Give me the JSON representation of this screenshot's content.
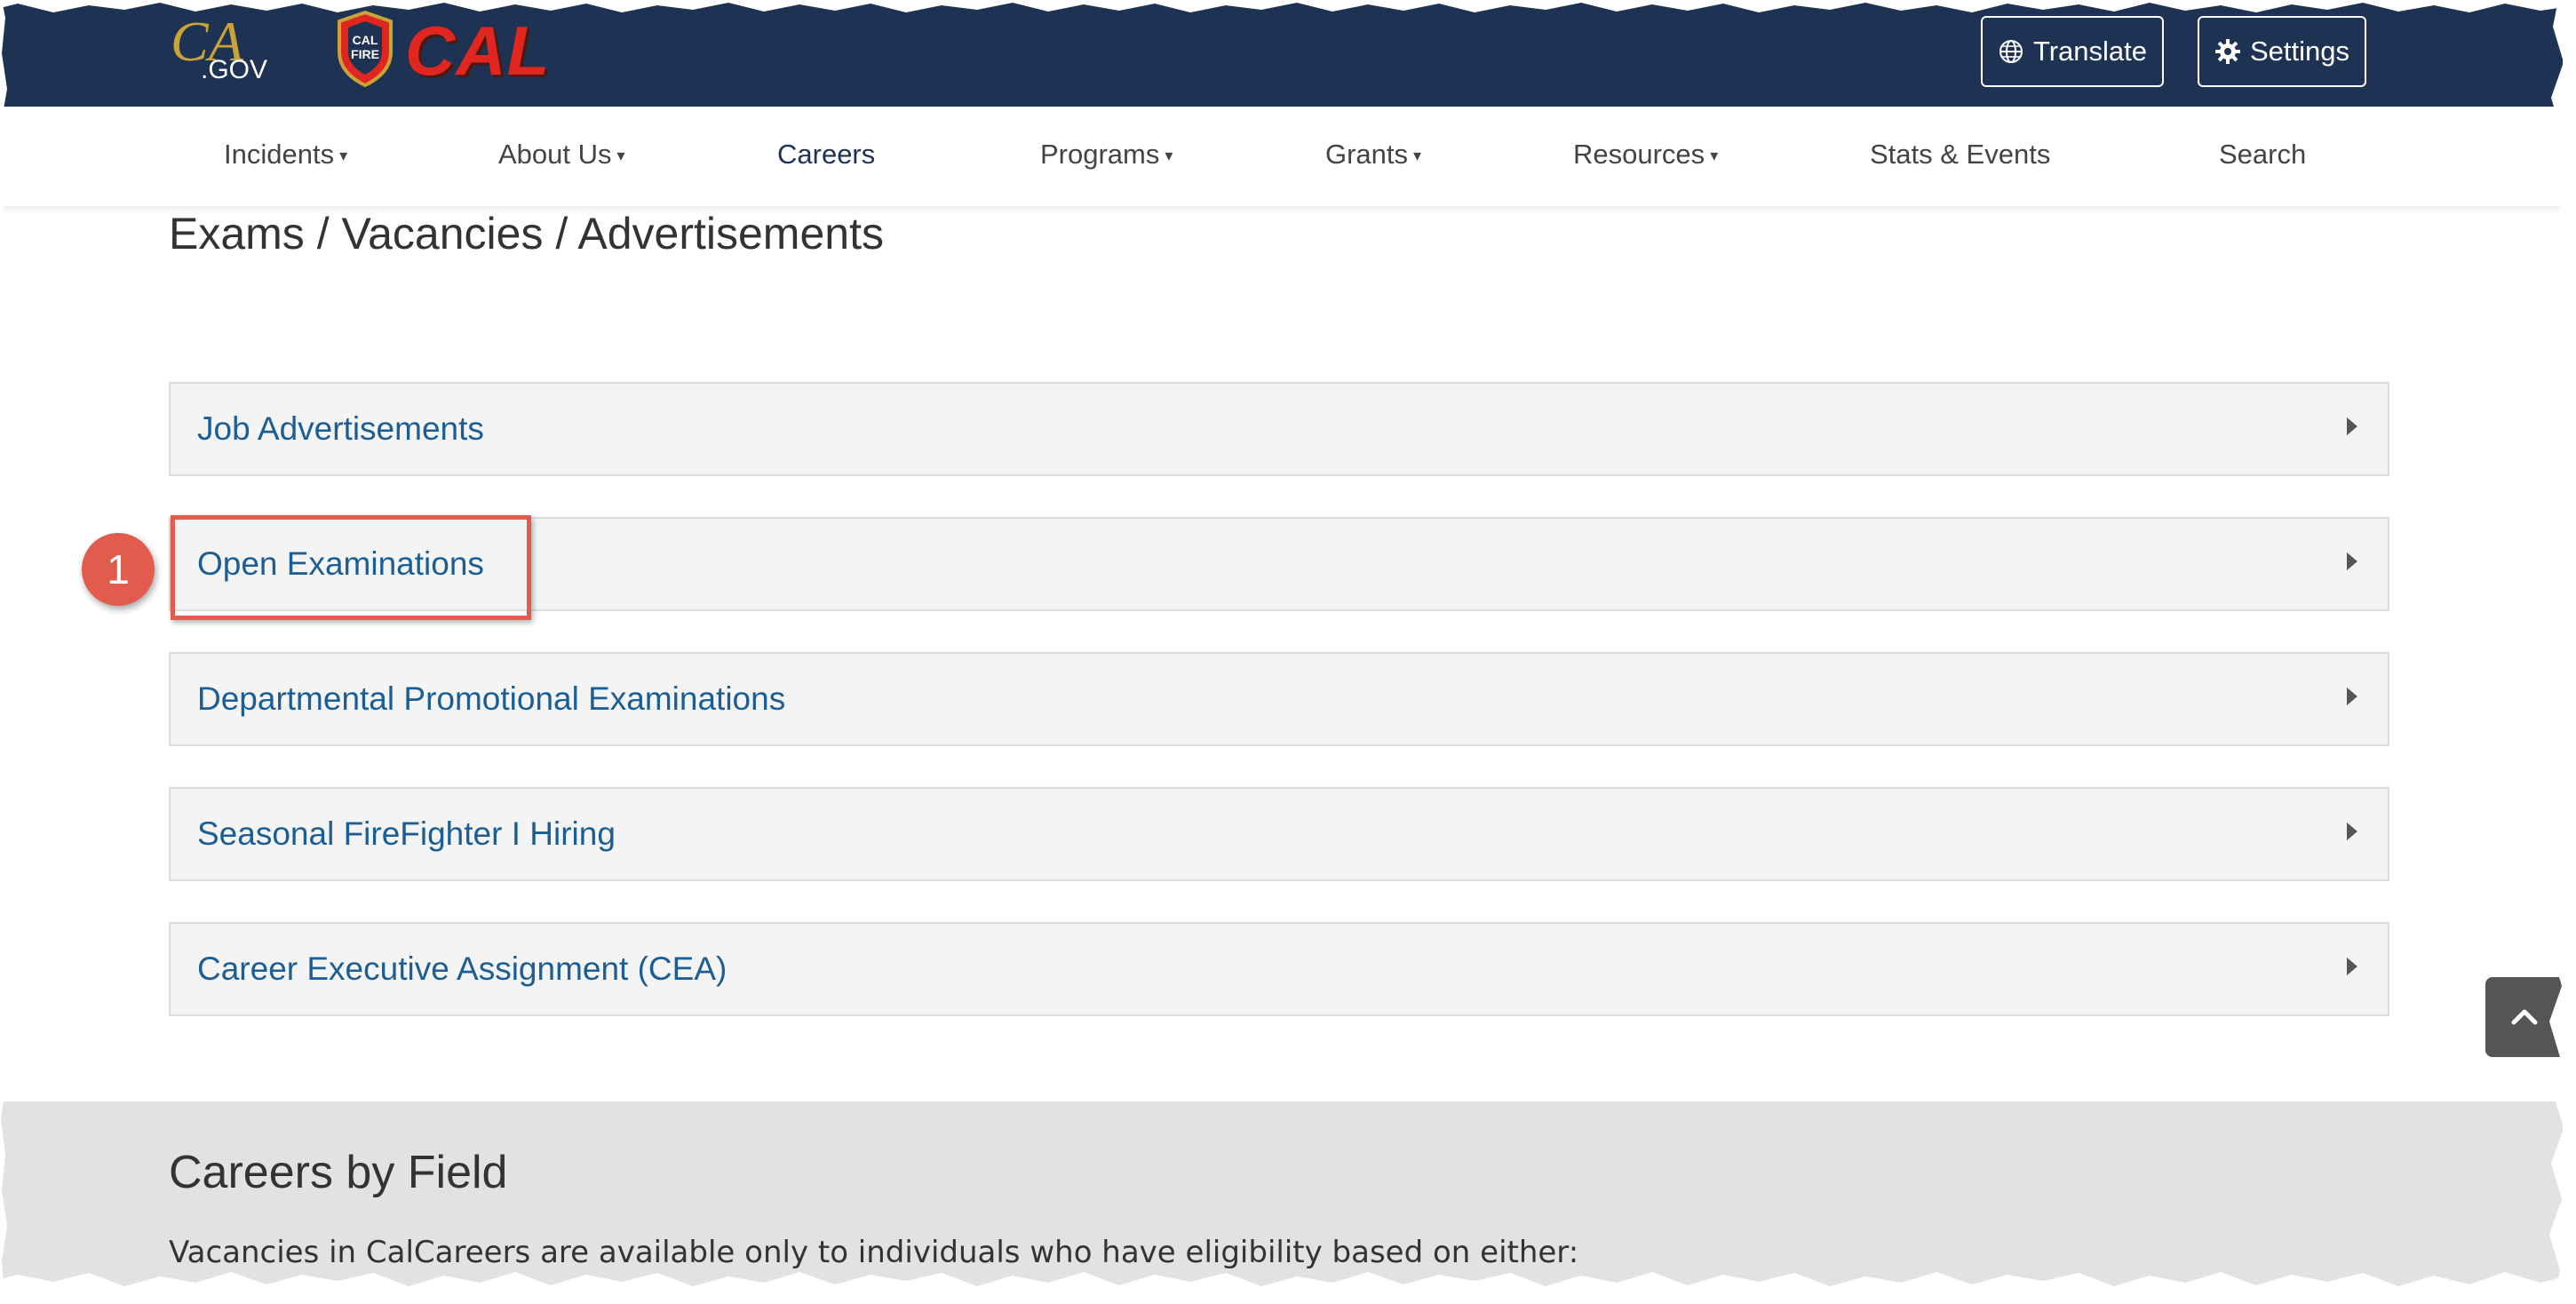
{
  "header": {
    "ca_logo_text": ".GOV",
    "ca_logo_mark": "CA",
    "brand": "CAL FIRE",
    "badge_text_1": "CAL",
    "badge_text_2": "FIRE",
    "translate_label": "Translate",
    "settings_label": "Settings",
    "colors": {
      "bar": "#1e3354",
      "brand_red": "#e0261e"
    }
  },
  "nav": {
    "items": [
      {
        "label": "Incidents",
        "dropdown": true
      },
      {
        "label": "About Us",
        "dropdown": true
      },
      {
        "label": "Careers",
        "dropdown": false
      },
      {
        "label": "Programs",
        "dropdown": true
      },
      {
        "label": "Grants",
        "dropdown": true
      },
      {
        "label": "Resources",
        "dropdown": true
      },
      {
        "label": "Stats & Events",
        "dropdown": false
      },
      {
        "label": "Search",
        "dropdown": false
      }
    ]
  },
  "main": {
    "title": "Exams / Vacancies / Advertisements",
    "accordion": [
      {
        "label": "Job Advertisements"
      },
      {
        "label": "Open Examinations"
      },
      {
        "label": "Departmental Promotional Examinations"
      },
      {
        "label": "Seasonal FireFighter I Hiring"
      },
      {
        "label": "Career Executive Assignment (CEA)"
      }
    ]
  },
  "annotation": {
    "step": "1",
    "color": "#e25c4d"
  },
  "careers": {
    "title": "Careers by Field",
    "text": "Vacancies in CalCareers are available only to individuals who have eligibility based on either:"
  }
}
